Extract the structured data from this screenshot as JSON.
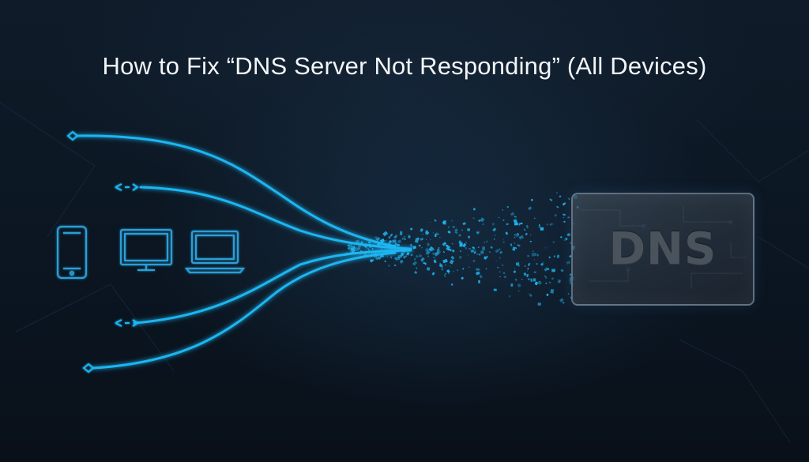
{
  "title": "How to Fix “DNS Server Not Responding” (All Devices)",
  "dns_box": {
    "label": "DNS"
  },
  "devices": [
    {
      "name": "smartphone-icon"
    },
    {
      "name": "desktop-monitor-icon"
    },
    {
      "name": "laptop-icon"
    }
  ],
  "colors": {
    "background": "#0b1420",
    "glow": "#1fb6f2",
    "device_stroke": "#2a9fd8",
    "title": "#f2f5f8"
  }
}
